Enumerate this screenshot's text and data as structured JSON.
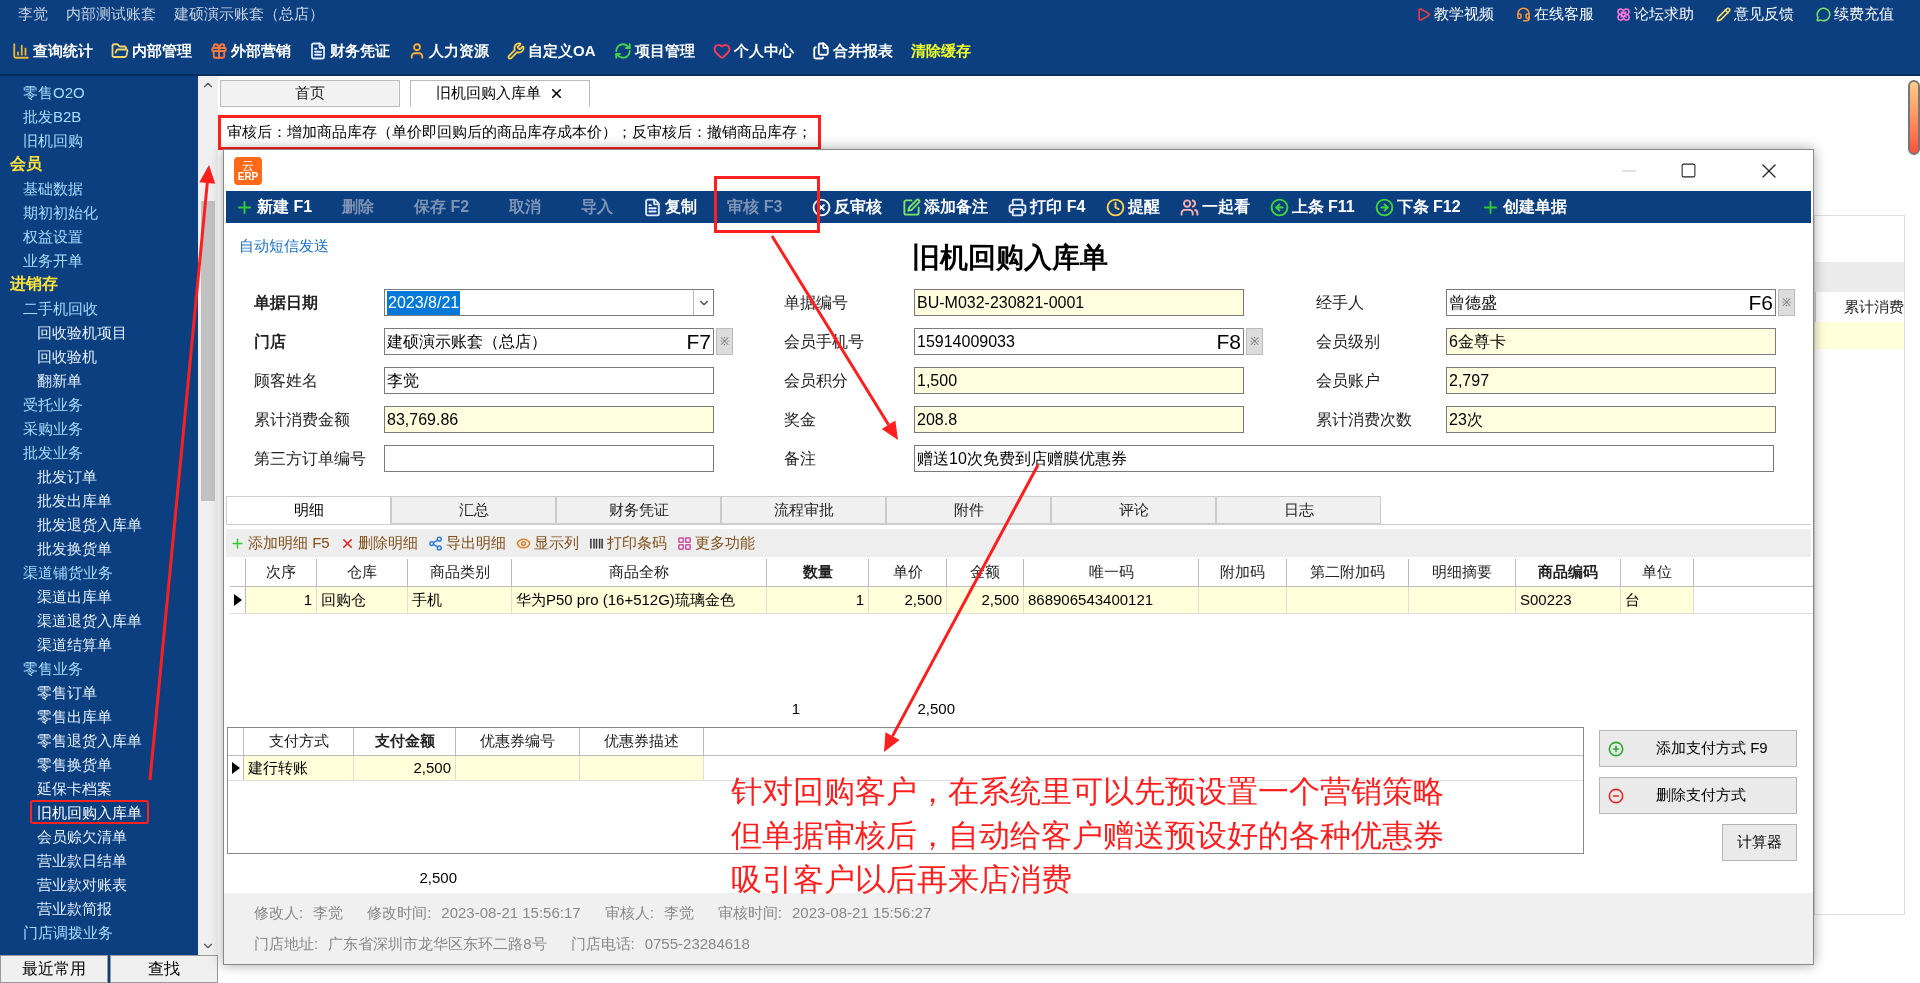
{
  "header": {
    "user": "李觉",
    "accounts": [
      "内部测试账套",
      "建硕演示账套（总店）"
    ],
    "links": [
      "教学视频",
      "在线客服",
      "论坛求助",
      "意见反馈",
      "续费充值"
    ],
    "menu": [
      {
        "label": "查询统计",
        "kind": "module"
      },
      {
        "label": "内部管理",
        "kind": "module"
      },
      {
        "label": "外部营销",
        "kind": "module"
      },
      {
        "label": "财务凭证",
        "kind": "module"
      },
      {
        "label": "人力资源",
        "kind": "module"
      },
      {
        "label": "自定义OA",
        "kind": "module"
      },
      {
        "label": "项目管理",
        "kind": "module"
      },
      {
        "label": "个人中心",
        "kind": "module"
      },
      {
        "label": "合并报表",
        "kind": "module"
      },
      {
        "label": "清除缓存",
        "kind": "action"
      }
    ]
  },
  "sidebar": {
    "items": [
      {
        "label": "零售O2O",
        "kind": "item",
        "selected": false
      },
      {
        "label": "批发B2B",
        "kind": "item",
        "selected": false
      },
      {
        "label": "旧机回购",
        "kind": "item",
        "selected": false
      },
      {
        "label": "会员",
        "kind": "section",
        "children": [
          {
            "label": "基础数据",
            "kind": "item",
            "selected": false
          },
          {
            "label": "期初初始化",
            "kind": "item",
            "selected": false
          },
          {
            "label": "权益设置",
            "kind": "item",
            "selected": false
          },
          {
            "label": "业务开单",
            "kind": "item",
            "selected": false
          }
        ]
      },
      {
        "label": "进销存",
        "kind": "section",
        "children": [
          {
            "label": "二手机回收",
            "kind": "item",
            "selected": false,
            "children": [
              {
                "label": "回收验机项目",
                "kind": "item",
                "selected": false
              },
              {
                "label": "回收验机",
                "kind": "item",
                "selected": false
              },
              {
                "label": "翻新单",
                "kind": "item",
                "selected": false
              }
            ]
          },
          {
            "label": "受托业务",
            "kind": "item",
            "selected": false
          },
          {
            "label": "采购业务",
            "kind": "item",
            "selected": false
          },
          {
            "label": "批发业务",
            "kind": "item",
            "selected": false,
            "children": [
              {
                "label": "批发订单",
                "kind": "item",
                "selected": false
              },
              {
                "label": "批发出库单",
                "kind": "item",
                "selected": false
              },
              {
                "label": "批发退货入库单",
                "kind": "item",
                "selected": false
              },
              {
                "label": "批发换货单",
                "kind": "item",
                "selected": false
              }
            ]
          },
          {
            "label": "渠道铺货业务",
            "kind": "item",
            "selected": false,
            "children": [
              {
                "label": "渠道出库单",
                "kind": "item",
                "selected": false
              },
              {
                "label": "渠道退货入库单",
                "kind": "item",
                "selected": false
              },
              {
                "label": "渠道结算单",
                "kind": "item",
                "selected": false
              }
            ]
          },
          {
            "label": "零售业务",
            "kind": "item",
            "selected": false,
            "children": [
              {
                "label": "零售订单",
                "kind": "item",
                "selected": false
              },
              {
                "label": "零售出库单",
                "kind": "item",
                "selected": false
              },
              {
                "label": "零售退货入库单",
                "kind": "item",
                "selected": false
              },
              {
                "label": "零售换货单",
                "kind": "item",
                "selected": false
              },
              {
                "label": "延保卡档案",
                "kind": "item",
                "selected": false
              },
              {
                "label": "旧机回购入库单",
                "kind": "item",
                "selected": true
              },
              {
                "label": "会员赊欠清单",
                "kind": "item",
                "selected": false
              },
              {
                "label": "营业款日结单",
                "kind": "item",
                "selected": false
              },
              {
                "label": "营业款对账表",
                "kind": "item",
                "selected": false
              },
              {
                "label": "营业款简报",
                "kind": "item",
                "selected": false
              }
            ]
          },
          {
            "label": "门店调拨业务",
            "kind": "item",
            "selected": false
          }
        ]
      }
    ],
    "bottom_buttons": [
      "最近常用",
      "查找"
    ]
  },
  "tabs": [
    {
      "label": "首页",
      "selected": false,
      "closable": false
    },
    {
      "label": "旧机回购入库单",
      "selected": true,
      "closable": true
    }
  ],
  "notice": "审核后：增加商品库存（单价即回购后的商品库存成本价）；反审核后：撤销商品库存；",
  "background_grid": {
    "column": "累计消费"
  },
  "dialog": {
    "logo": {
      "top": "云",
      "bottom": "ERP"
    },
    "toolbar": [
      {
        "label": "新建 F1",
        "disabled": false
      },
      {
        "label": "删除",
        "disabled": true
      },
      {
        "label": "保存 F2",
        "disabled": true
      },
      {
        "label": "取消",
        "disabled": true
      },
      {
        "label": "导入",
        "disabled": true
      },
      {
        "label": "复制",
        "disabled": false
      },
      {
        "label": "审核 F3",
        "disabled": true
      },
      {
        "label": "反审核",
        "disabled": false
      },
      {
        "label": "添加备注",
        "disabled": false
      },
      {
        "label": "打印 F4",
        "disabled": false
      },
      {
        "label": "提醒",
        "disabled": false
      },
      {
        "label": "一起看",
        "disabled": false
      },
      {
        "label": "上条 F11",
        "disabled": false
      },
      {
        "label": "下条 F12",
        "disabled": false
      },
      {
        "label": "创建单据",
        "disabled": false
      }
    ],
    "sms_link": "自动短信发送",
    "title": "旧机回购入库单",
    "fields": [
      {
        "label": "单据日期",
        "required": true,
        "kind": "date",
        "value": "2023/8/21",
        "highlighted": true,
        "readonly": false
      },
      {
        "label": "单据编号",
        "required": false,
        "kind": "text",
        "value": "BU-M032-230821-0001",
        "readonly": true
      },
      {
        "label": "经手人",
        "required": false,
        "kind": "lookup",
        "value": "曾德盛",
        "key": "F6",
        "button": "※",
        "readonly": false
      },
      {
        "label": "门店",
        "required": true,
        "kind": "lookup",
        "value": "建硕演示账套（总店）",
        "key": "F7",
        "button": "※",
        "readonly": false
      },
      {
        "label": "会员手机号",
        "required": false,
        "kind": "lookup",
        "value": "15914009033",
        "key": "F8",
        "button": "※",
        "readonly": false
      },
      {
        "label": "会员级别",
        "required": false,
        "kind": "text",
        "value": "6金尊卡",
        "readonly": true
      },
      {
        "label": "顾客姓名",
        "required": false,
        "kind": "text",
        "value": "李觉",
        "readonly": false
      },
      {
        "label": "会员积分",
        "required": false,
        "kind": "text",
        "value": "1,500",
        "readonly": true
      },
      {
        "label": "会员账户",
        "required": false,
        "kind": "text",
        "value": "2,797",
        "readonly": true
      },
      {
        "label": "累计消费金额",
        "required": false,
        "kind": "text",
        "value": "83,769.86",
        "readonly": true
      },
      {
        "label": "奖金",
        "required": false,
        "kind": "text",
        "value": "208.8",
        "readonly": true
      },
      {
        "label": "累计消费次数",
        "required": false,
        "kind": "text",
        "value": "23次",
        "readonly": true
      },
      {
        "label": "第三方订单编号",
        "required": false,
        "kind": "text",
        "readonly": false
      },
      {
        "label": "备注",
        "required": false,
        "kind": "memo",
        "value": "赠送10次免费到店赠膜优惠券",
        "readonly": false
      }
    ],
    "detail_tabs": [
      {
        "label": "明细",
        "selected": true
      },
      {
        "label": "汇总",
        "selected": false
      },
      {
        "label": "财务凭证",
        "selected": false
      },
      {
        "label": "流程审批",
        "selected": false
      },
      {
        "label": "附件",
        "selected": false
      },
      {
        "label": "评论",
        "selected": false
      },
      {
        "label": "日志",
        "selected": false
      }
    ],
    "detail_toolbar": [
      "添加明细 F5",
      "删除明细",
      "导出明细",
      "显示列",
      "打印条码",
      "更多功能"
    ],
    "detail_table": {
      "columns": [
        {
          "label": "次序",
          "bold": false
        },
        {
          "label": "仓库",
          "bold": false
        },
        {
          "label": "商品类别",
          "bold": false
        },
        {
          "label": "商品全称",
          "bold": false
        },
        {
          "label": "数量",
          "bold": true
        },
        {
          "label": "单价",
          "bold": false
        },
        {
          "label": "金额",
          "bold": false
        },
        {
          "label": "唯一码",
          "bold": false
        },
        {
          "label": "附加码",
          "bold": false
        },
        {
          "label": "第二附加码",
          "bold": false
        },
        {
          "label": "明细摘要",
          "bold": false
        },
        {
          "label": "商品编码",
          "bold": true
        },
        {
          "label": "单位",
          "bold": false
        }
      ],
      "rows": [
        {
          "current": true,
          "cells": [
            "1",
            "回购仓",
            "手机",
            "华为P50 pro (16+512G)琉璃金色",
            "1",
            "2,500",
            "2,500",
            "868906543400121",
            null,
            null,
            null,
            "S00223",
            "台"
          ]
        }
      ],
      "totals": {
        "quantity": "1",
        "amount": "2,500"
      }
    },
    "payment_table": {
      "columns": [
        {
          "label": "支付方式",
          "bold": false
        },
        {
          "label": "支付金额",
          "bold": true
        },
        {
          "label": "优惠券编号",
          "bold": false
        },
        {
          "label": "优惠券描述",
          "bold": false
        }
      ],
      "rows": [
        {
          "current": true,
          "cells": [
            "建行转账",
            "2,500",
            null,
            null
          ]
        }
      ],
      "total": "2,500"
    },
    "payment_buttons": [
      "添加支付方式 F9",
      "删除支付方式",
      "计算器"
    ],
    "footer": [
      [
        {
          "label": "修改人:",
          "value": "李觉"
        },
        {
          "label": "修改时间:",
          "value": "2023-08-21 15:56:17"
        },
        {
          "label": "审核人:",
          "value": "李觉"
        },
        {
          "label": "审核时间:",
          "value": "2023-08-21 15:56:27"
        }
      ],
      [
        {
          "label": "门店地址:",
          "value": "广东省深圳市龙华区东环二路8号"
        },
        {
          "label": "门店电话:",
          "value": "0755-23284618"
        }
      ]
    ]
  },
  "annotation": {
    "lines": [
      "针对回购客户，在系统里可以先预设置一个营销策略",
      "但单据审核后，自动给客户赠送预设好的各种优惠券",
      "吸引客户以后再来店消费"
    ]
  }
}
